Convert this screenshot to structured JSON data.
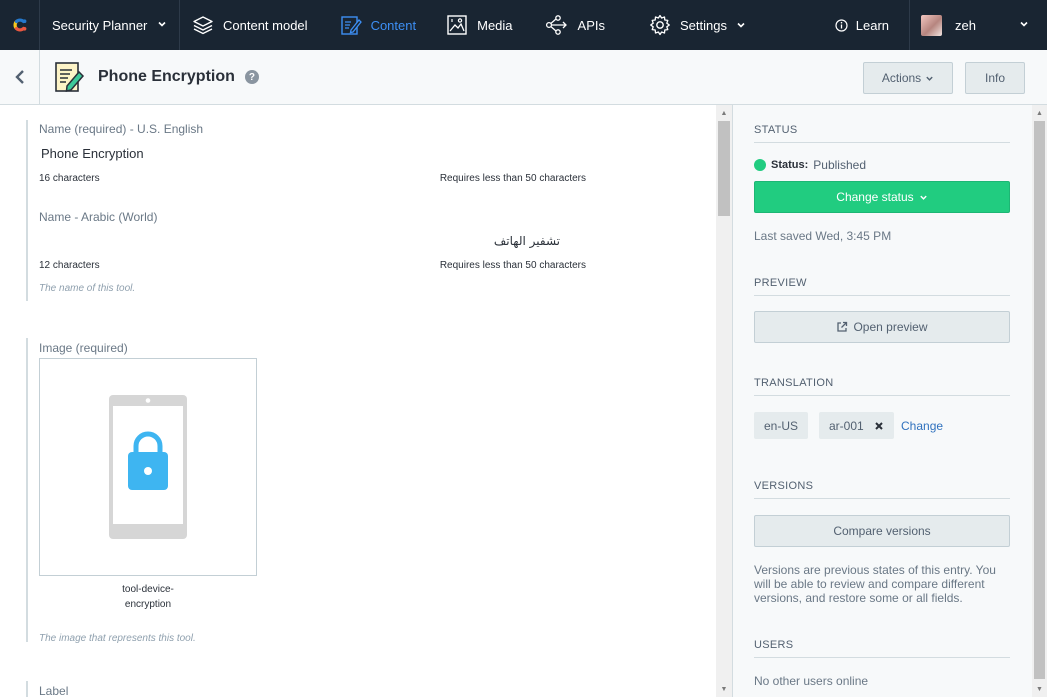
{
  "nav": {
    "space": "Security Planner",
    "items": [
      {
        "label": "Content model",
        "icon": "layers-icon"
      },
      {
        "label": "Content",
        "icon": "content-edit-icon",
        "active": true
      },
      {
        "label": "Media",
        "icon": "image-icon"
      },
      {
        "label": "APIs",
        "icon": "apis-icon"
      },
      {
        "label": "Settings",
        "icon": "gear-icon"
      }
    ],
    "learn": "Learn",
    "user": "zeh",
    "colors": {
      "bar": "#192532",
      "active": "#3d8ff4"
    }
  },
  "entry": {
    "title": "Phone Encryption",
    "help": "?",
    "actions_label": "Actions",
    "info_label": "Info"
  },
  "fields": {
    "name_en": {
      "label": "Name (required) - U.S. English",
      "value": "Phone Encryption",
      "count": "16 characters",
      "limit": "Requires less than 50 characters"
    },
    "name_ar": {
      "label": "Name - Arabic (World)",
      "value": "تشفير الهاتف",
      "count": "12 characters",
      "limit": "Requires less than 50 characters"
    },
    "name_help": "The name of this tool.",
    "image": {
      "label": "Image (required)",
      "filename_line1": "tool-device-",
      "filename_line2": "encryption",
      "help": "The image that represents this tool."
    },
    "label_field": {
      "label": "Label"
    }
  },
  "sidebar": {
    "status": {
      "title": "STATUS",
      "status_label": "Status:",
      "status_value": "Published",
      "change_button": "Change status",
      "last_saved": "Last saved Wed, 3:45 PM",
      "color": "#21cc80"
    },
    "preview": {
      "title": "PREVIEW",
      "button": "Open preview"
    },
    "translation": {
      "title": "TRANSLATION",
      "locales": [
        "en-US",
        "ar-001"
      ],
      "change_link": "Change"
    },
    "versions": {
      "title": "VERSIONS",
      "button": "Compare versions",
      "description": "Versions are previous states of this entry. You will be able to review and compare different versions, and restore some or all fields."
    },
    "users": {
      "title": "USERS",
      "text": "No other users online"
    }
  }
}
